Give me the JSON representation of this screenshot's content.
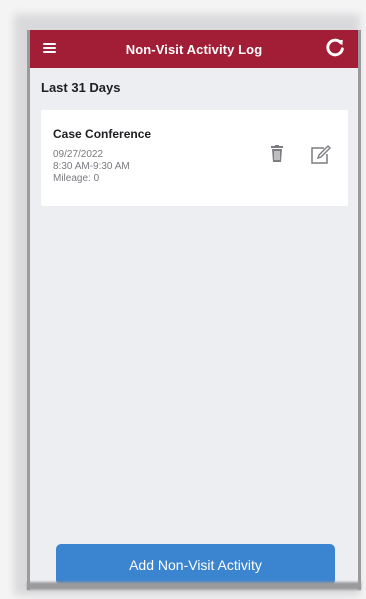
{
  "header": {
    "title": "Non-Visit Activity Log",
    "menu_icon": "hamburger-menu-icon",
    "refresh_icon": "refresh-icon",
    "background_color": "#a21e36"
  },
  "section": {
    "title": "Last 31 Days"
  },
  "activities": [
    {
      "title": "Case Conference",
      "date": "09/27/2022",
      "time": "8:30 AM-9:30 AM",
      "mileage": "Mileage: 0",
      "delete_icon": "trash-icon",
      "edit_icon": "edit-icon"
    }
  ],
  "footer": {
    "add_button_label": "Add Non-Visit Activity",
    "button_color": "#3b84cf"
  }
}
